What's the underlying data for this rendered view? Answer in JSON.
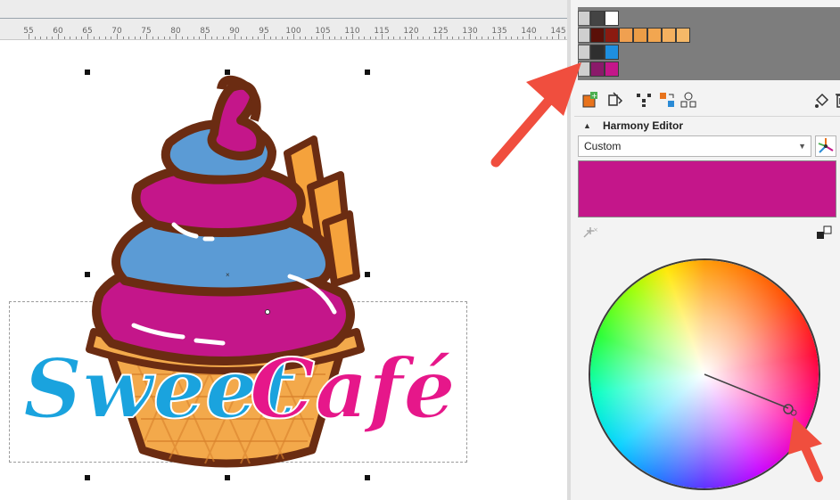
{
  "ruler": {
    "ticks": [
      "55",
      "60",
      "65",
      "70",
      "75",
      "80",
      "85",
      "90",
      "95",
      "100",
      "105",
      "110",
      "115",
      "120",
      "125",
      "130",
      "135",
      "140",
      "145"
    ]
  },
  "logo": {
    "word1": "Sweet",
    "word2": "Café",
    "colors": {
      "blue": "#1aa3de",
      "pink": "#e6178a",
      "swirl_pink": "#c4168a",
      "swirl_blue": "#5b9bd5",
      "outline": "#6b2c12",
      "cone": "#f3a94b",
      "wafer": "#f5a23c"
    }
  },
  "palette": {
    "rows": [
      {
        "name": "row-1",
        "colors": [
          "#444444",
          "#ffffff"
        ]
      },
      {
        "name": "row-2",
        "colors": [
          "#5a1008",
          "#8b1a10",
          "#f0a050",
          "#eb9d47",
          "#f2a650",
          "#f3b05f",
          "#f5b868"
        ]
      },
      {
        "name": "row-3",
        "colors": [
          "#2f2f2f",
          "#1e8fe0"
        ]
      },
      {
        "name": "row-4",
        "colors": [
          "#8a1a6a",
          "#c4168a"
        ]
      }
    ]
  },
  "toolbar": {
    "icons": [
      "add-harmony-icon",
      "edit-harmony-icon",
      "distribute-icon",
      "swap-colors-icon",
      "group-icon",
      "paint-bucket-icon",
      "trash-icon"
    ]
  },
  "harmony_editor": {
    "title": "Harmony Editor",
    "rule_value": "Custom",
    "selected_color": "#c4168a"
  }
}
